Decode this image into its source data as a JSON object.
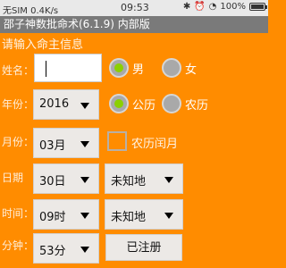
{
  "status_bar": {
    "left": "无SIM 0.4K/s",
    "time": "09:53",
    "battery": "100%"
  },
  "app_title": "邵子神数批命术(6.1.9) 内部版",
  "section_title": "请输入命主信息",
  "labels": {
    "name": "姓名：",
    "year": "年份：",
    "month": "月份：",
    "day": "日期",
    "hour": "时间：",
    "minute": "分钟："
  },
  "name_field": {
    "value": "",
    "placeholder": ""
  },
  "gender": {
    "male": "男",
    "female": "女",
    "selected": "male"
  },
  "calendar": {
    "solar": "公历",
    "lunar": "农历",
    "selected": "solar"
  },
  "year_select": {
    "value": "2016"
  },
  "month_select": {
    "value": "03月"
  },
  "leap_month": {
    "label": "农历闰月",
    "checked": false
  },
  "day_select": {
    "value": "30日"
  },
  "place_select_1": {
    "value": "未知地"
  },
  "hour_select": {
    "value": "09时"
  },
  "place_select_2": {
    "value": "未知地"
  },
  "minute_select": {
    "value": "53分"
  },
  "registered_button": {
    "label": "已注册"
  }
}
